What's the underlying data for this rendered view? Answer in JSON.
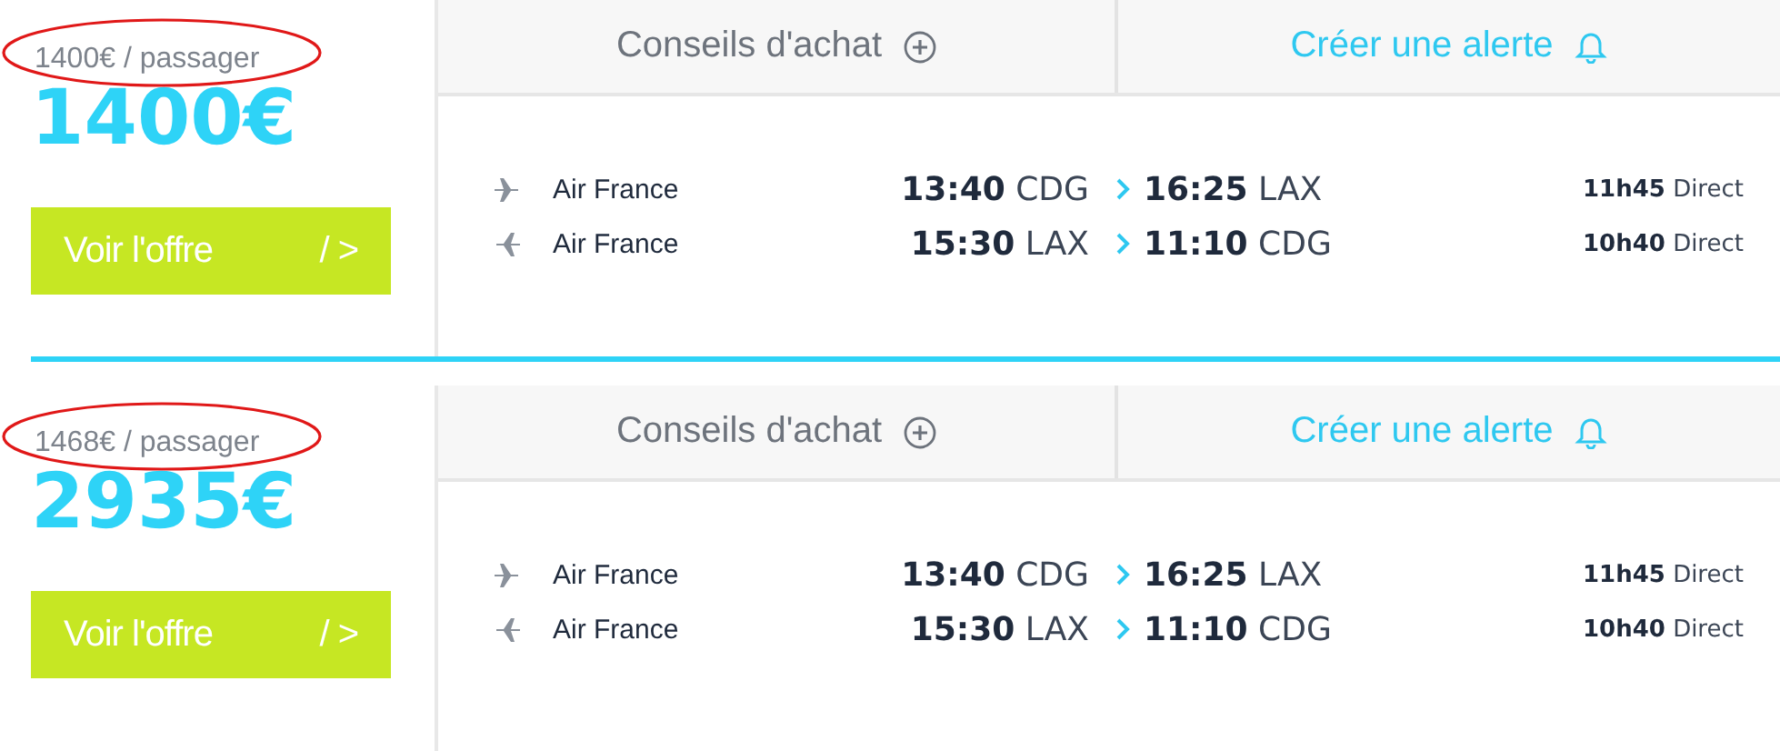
{
  "offers": [
    {
      "per_passenger": "1400€ / passager",
      "annotated": true,
      "price": "1400€",
      "button": {
        "label": "Voir l'offre",
        "arrow": "/ >"
      },
      "tabs": [
        {
          "label": "Conseils d'achat",
          "kind": "advice"
        },
        {
          "label": "Créer une alerte",
          "kind": "alert"
        }
      ],
      "flights": [
        {
          "kind": "outbound",
          "airline": "Air France",
          "dep_time": "13:40",
          "dep_airport": "CDG",
          "arr_time": "16:25",
          "arr_airport": "LAX",
          "duration": "11h45",
          "stops": "Direct"
        },
        {
          "kind": "return",
          "airline": "Air France",
          "dep_time": "15:30",
          "dep_airport": "LAX",
          "arr_time": "11:10",
          "arr_airport": "CDG",
          "duration": "10h40",
          "stops": "Direct"
        }
      ]
    },
    {
      "per_passenger": "1468€ / passager",
      "annotated": true,
      "price": "2935€",
      "button": {
        "label": "Voir l'offre",
        "arrow": "/ >"
      },
      "tabs": [
        {
          "label": "Conseils d'achat",
          "kind": "advice"
        },
        {
          "label": "Créer une alerte",
          "kind": "alert"
        }
      ],
      "flights": [
        {
          "kind": "outbound",
          "airline": "Air France",
          "dep_time": "13:40",
          "dep_airport": "CDG",
          "arr_time": "16:25",
          "arr_airport": "LAX",
          "duration": "11h45",
          "stops": "Direct"
        },
        {
          "kind": "return",
          "airline": "Air France",
          "dep_time": "15:30",
          "dep_airport": "LAX",
          "arr_time": "11:10",
          "arr_airport": "CDG",
          "duration": "10h40",
          "stops": "Direct"
        }
      ]
    }
  ]
}
